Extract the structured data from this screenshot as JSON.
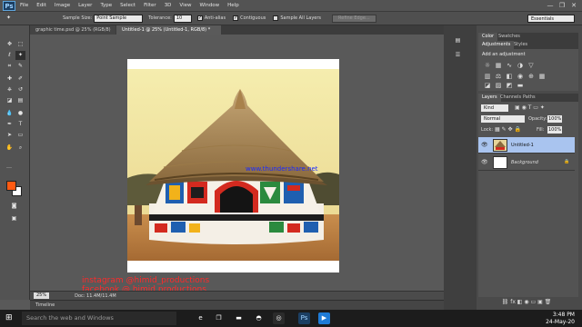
{
  "app": {
    "logo": "Ps",
    "menu": [
      "File",
      "Edit",
      "Image",
      "Layer",
      "Type",
      "Select",
      "Filter",
      "3D",
      "View",
      "Window",
      "Help"
    ],
    "window_controls": [
      "—",
      "❐",
      "✕"
    ]
  },
  "options_bar": {
    "sample_size_label": "Sample Size:",
    "sample_size_value": "Point Sample",
    "tolerance_label": "Tolerance:",
    "tolerance_value": "10",
    "anti_alias_label": "Anti-alias",
    "contiguous_label": "Contiguous",
    "sample_all_layers_label": "Sample All Layers",
    "refine_edge_label": "Refine Edge...",
    "workspace": "Essentials"
  },
  "doc_tabs": [
    {
      "label": "graphic time.psd @ 25% (RGB/8)",
      "active": false
    },
    {
      "label": "Untitled-1 @ 25% (Untitled-1, RGB/8) *",
      "active": true
    }
  ],
  "canvas": {
    "watermark": "www.thundershare.net"
  },
  "status": {
    "zoom": "25%",
    "doc_info": "Doc: 11.4M/11.4M",
    "timeline_label": "Timeline"
  },
  "social": {
    "line1": "instagram @himid_productions",
    "line2": "facebook @ himid productions"
  },
  "panels": {
    "top_tabs": [
      "Color",
      "Swatches"
    ],
    "adj_tabs": [
      "Adjustments",
      "Styles"
    ],
    "adj_title": "Add an adjustment",
    "layer_tabs": [
      "Layers",
      "Channels",
      "Paths"
    ],
    "kind_label": "Kind",
    "blend_mode": "Normal",
    "opacity_label": "Opacity:",
    "opacity_value": "100%",
    "lock_label": "Lock:",
    "fill_label": "Fill:",
    "fill_value": "100%",
    "layers": [
      {
        "name": "Untitled-1",
        "selected": true
      },
      {
        "name": "Background",
        "selected": false
      }
    ]
  },
  "taskbar": {
    "search_placeholder": "Search the web and Windows",
    "time": "3:48 PM",
    "date": "24-May-20"
  },
  "colors": {
    "foreground": "#ff5a12",
    "background": "#ffffff",
    "accent": "#1e90ff"
  }
}
